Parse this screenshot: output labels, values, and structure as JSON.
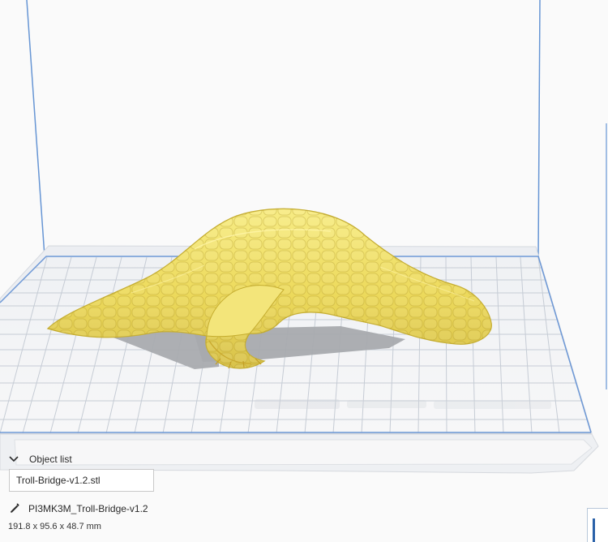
{
  "viewport": {
    "background": "#fafafa",
    "model_color": "#f1e36a",
    "bed_grid_color": "#c9ced6",
    "build_volume_line_color": "#5f8fd0"
  },
  "object_panel": {
    "title": "Object list",
    "object_name": "Troll-Bridge-v1.2.stl",
    "job_name": "PI3MK3M_Troll-Bridge-v1.2",
    "dimensions": "191.8 x 95.6 x 48.7 mm",
    "icons": {
      "collapse": "chevron-down-icon",
      "edit": "pencil-icon"
    }
  }
}
